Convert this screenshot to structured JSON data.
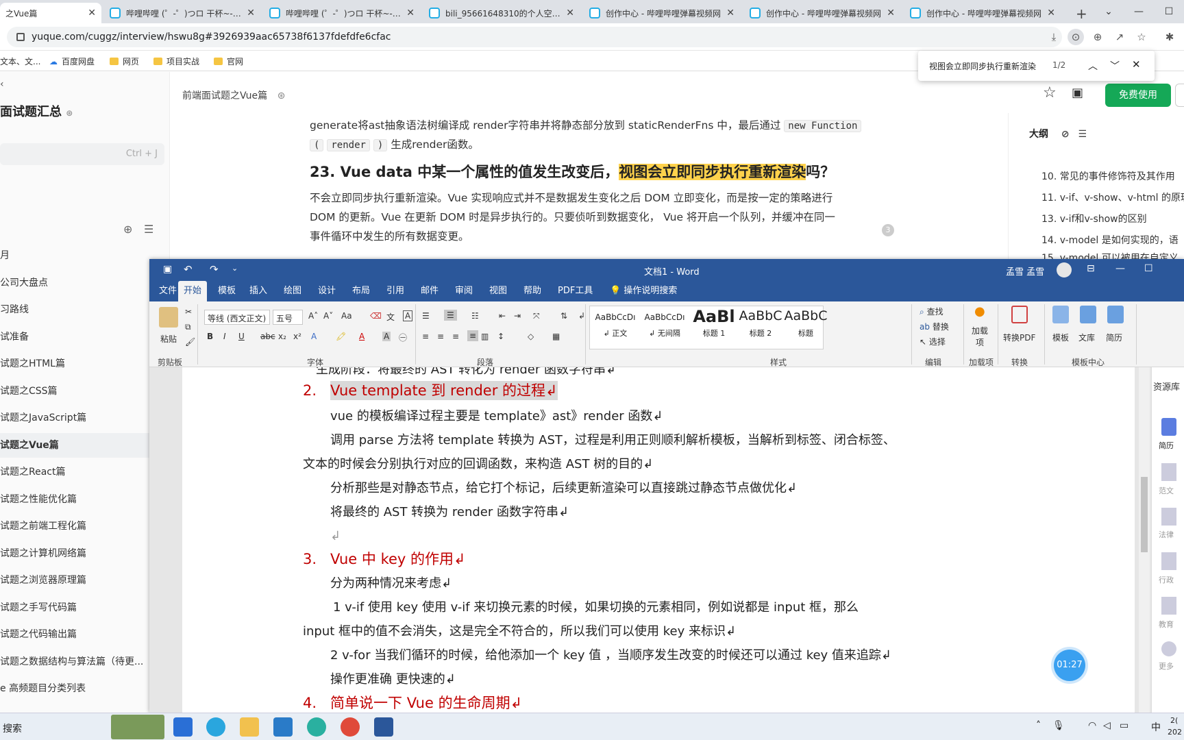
{
  "browser": {
    "tabs": [
      {
        "label": "之Vue篇",
        "active": true
      },
      {
        "label": "哔哩哔哩 (゜-゜)つロ 干杯~-bili",
        "active": false
      },
      {
        "label": "哔哩哔哩 (゜-゜)つロ 干杯~-bili",
        "active": false
      },
      {
        "label": "bili_95661648310的个人空间_",
        "active": false
      },
      {
        "label": "创作中心 - 哔哩哔哩弹幕视频网",
        "active": false
      },
      {
        "label": "创作中心 - 哔哩哔哩弹幕视频网",
        "active": false
      },
      {
        "label": "创作中心 - 哔哩哔哩弹幕视频网",
        "active": false
      }
    ],
    "url": "yuque.com/cuggz/interview/hswu8g#3926939aac65738f6137fdefdfe6cfac",
    "bookmarks": [
      "文本、文...",
      "百度网盘",
      "网页",
      "项目实战",
      "官网"
    ]
  },
  "find": {
    "query": "视图会立即同步执行重新渲染",
    "count": "1/2"
  },
  "yuque": {
    "sidebar_title": "面试题汇总",
    "search_shortcut": "Ctrl + J",
    "nav": [
      "月",
      "公司大盘点",
      "习路线",
      "试准备",
      "试题之HTML篇",
      "试题之CSS篇",
      "试题之JavaScript篇",
      "试题之Vue篇",
      "试题之React篇",
      "试题之性能优化篇",
      "试题之前端工程化篇",
      "试题之计算机网络篇",
      "试题之浏览器原理篇",
      "试题之手写代码篇",
      "试题之代码输出篇",
      "试题之数据结构与算法篇（待更...",
      "e 高频题目分类列表"
    ],
    "breadcrumb": "前端面试题之Vue篇",
    "free_button": "免费使用",
    "para1_a": "generate将ast抽象语法树编译成 render字符串并将静态部分放到 staticRenderFns 中，最后通过",
    "code1": "new Function",
    "code2": "(",
    "code3": "render",
    "code4": ")",
    "para1_b": "生成render函数。",
    "heading_a": "23. Vue data 中某一个属性的值发生改变后，",
    "heading_hl": "视图会立即同步执行重新渲染",
    "heading_b": "吗？",
    "para2_l1": "不会立即同步执行重新渲染。Vue 实现响应式并不是数据发生变化之后 DOM 立即变化，而是按一定的策略进行",
    "para2_l2": "DOM 的更新。Vue 在更新 DOM 时是异步执行的。只要侦听到数据变化， Vue 将开启一个队列，并缓冲在同一",
    "para2_l3": "事件循环中发生的所有数据变更。",
    "comment_count": "3",
    "outline_title": "大纲",
    "outline": [
      "10. 常见的事件修饰符及其作用",
      "11. v-if、v-show、v-html 的原理",
      "13. v-if和v-show的区别",
      "14. v-model 是如何实现的，语",
      "15. v-model 可以被用在自定义"
    ]
  },
  "word": {
    "title": "文档1 - Word",
    "user": "孟雪 孟雪",
    "menu": [
      "文件",
      "开始",
      "模板",
      "插入",
      "绘图",
      "设计",
      "布局",
      "引用",
      "邮件",
      "审阅",
      "视图",
      "帮助",
      "PDF工具",
      "操作说明搜索"
    ],
    "font_name": "等线 (西文正文)",
    "font_size": "五号",
    "groups": [
      "剪贴板",
      "字体",
      "段落",
      "样式",
      "编辑",
      "加载项",
      "转换",
      "模板中心"
    ],
    "paste": "粘贴",
    "styles": [
      {
        "preview": "AaBbCcDı",
        "name": "↲ 正文"
      },
      {
        "preview": "AaBbCcDı",
        "name": "↲ 无间隔"
      },
      {
        "preview": "AaBl",
        "name": "标题 1"
      },
      {
        "preview": "AaBbC",
        "name": "标题 2"
      },
      {
        "preview": "AaBbC",
        "name": "标题"
      }
    ],
    "edit": [
      "查找",
      "替换",
      "选择"
    ],
    "addin": "加载项",
    "convert": "转换PDF",
    "template_items": [
      "模板",
      "文库",
      "简历"
    ],
    "side_panel": [
      "资源库",
      "简历",
      "范文",
      "法律",
      "行政",
      "教育",
      "更多"
    ],
    "doc_lines": {
      "top_cut": "生成阶段：将最终的 AST 转化为 render 函数字符串↲",
      "h2_num": "2.",
      "h2": "Vue template  到  render  的过程↲",
      "l1": "vue 的模板编译过程主要是 template》ast》render 函数↲",
      "l2": "调用 parse 方法将 template 转换为 AST，过程是利用正则顺利解析模板，当解析到标签、闭合标签、",
      "l3": "文本的时候会分别执行对应的回调函数，来构造 AST 树的目的↲",
      "l4": "分析那些是对静态节点，给它打个标记，后续更新渲染可以直接跳过静态节点做优化↲",
      "l5": "将最终的 AST 转换为 render 函数字符串↲",
      "l6": "↲",
      "h3_num": "3.",
      "h3": "Vue 中 key 的作用↲",
      "l7": "分为两种情况来考虑↲",
      "l8": "1 v-if 使用 key      使用 v-if 来切换元素的时候，如果切换的元素相同，例如说都是 input 框，那么",
      "l9": "input 框中的值不会消失，这是完全不符合的，所以我们可以使用 key 来标识↲",
      "l10": "2 v-for  当我们循环的时候，给他添加一个 key 值 ，当顺序发生改变的时候还可以通过 key 值来追踪↲",
      "l11": "操作更准确  更快速的↲",
      "h4_num": "4.",
      "h4": "简单说一下 Vue 的生命周期↲"
    }
  },
  "timer": "01:27",
  "taskbar": {
    "search": "搜索",
    "ime": "中",
    "clock_top": "2(",
    "clock_bottom": "202"
  }
}
